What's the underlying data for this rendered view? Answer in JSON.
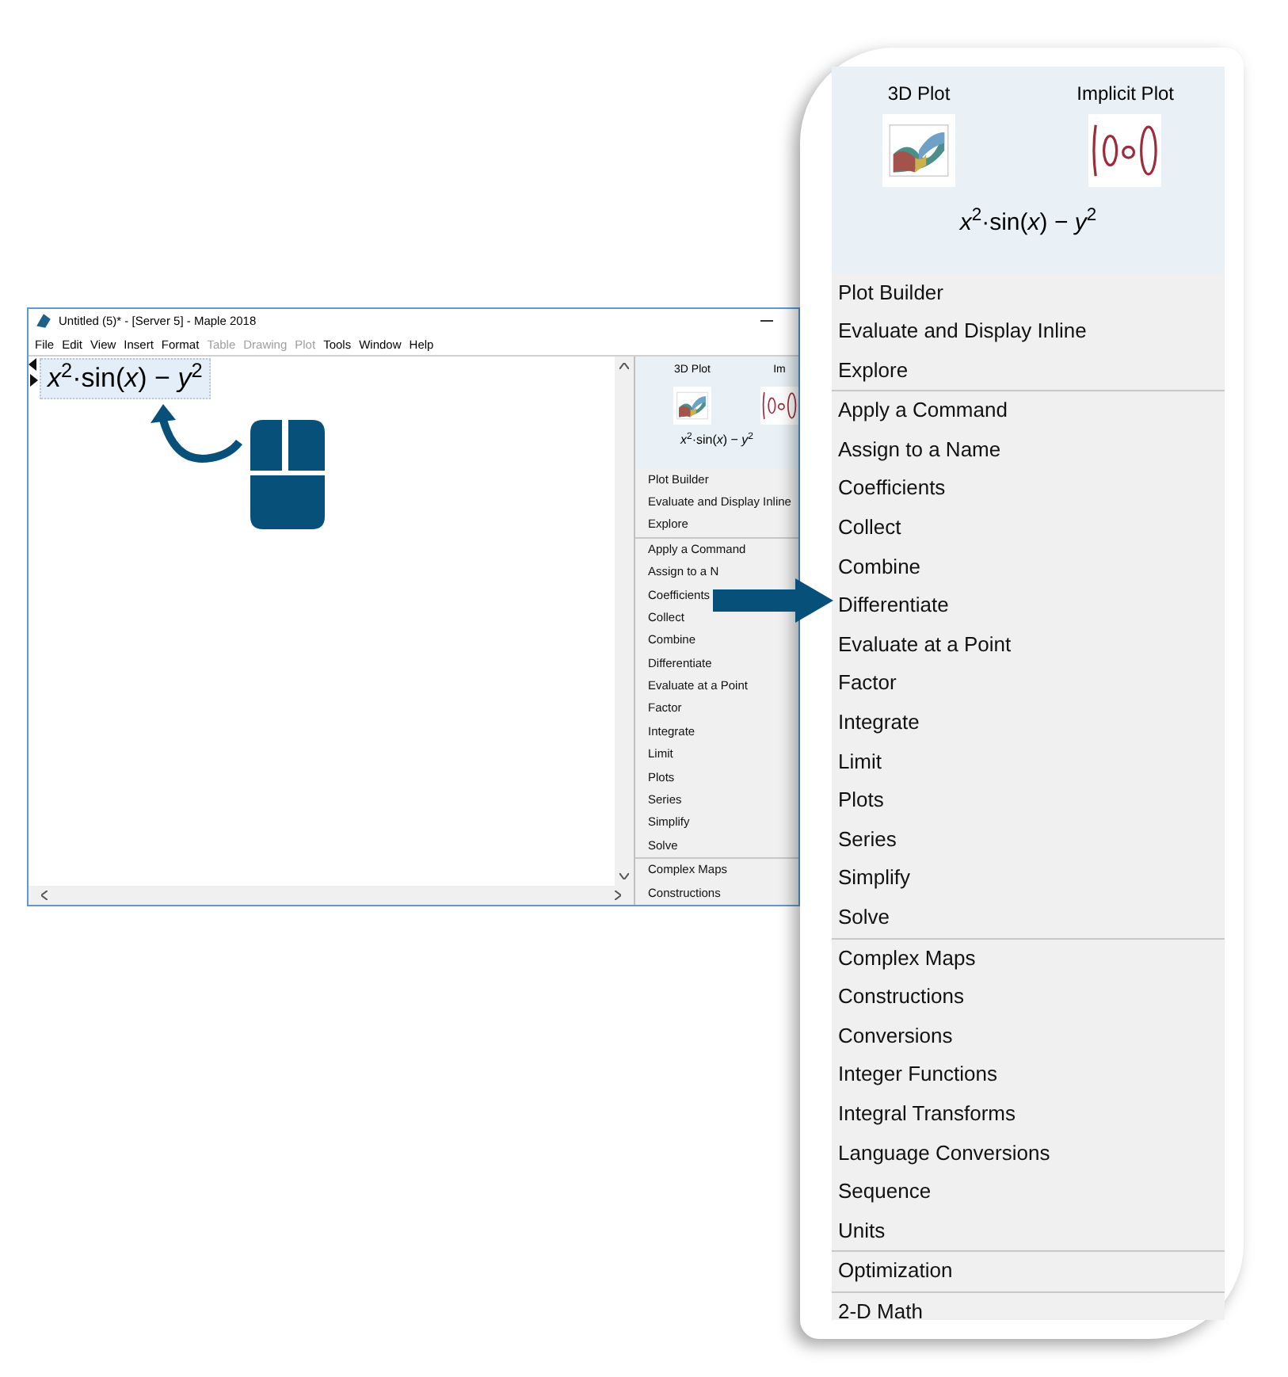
{
  "window": {
    "title": "Untitled (5)* - [Server 5] - Maple 2018",
    "menu": [
      {
        "label": "File",
        "disabled": false
      },
      {
        "label": "Edit",
        "disabled": false
      },
      {
        "label": "View",
        "disabled": false
      },
      {
        "label": "Insert",
        "disabled": false
      },
      {
        "label": "Format",
        "disabled": false
      },
      {
        "label": "Table",
        "disabled": true
      },
      {
        "label": "Drawing",
        "disabled": true
      },
      {
        "label": "Plot",
        "disabled": true
      },
      {
        "label": "Tools",
        "disabled": false
      },
      {
        "label": "Window",
        "disabled": false
      },
      {
        "label": "Help",
        "disabled": false
      }
    ],
    "expression": "*x*$^{2}$·sin(*x*) − *y*$^{2}$",
    "palette": {
      "plots": [
        {
          "label": "3D Plot",
          "kind": "surface"
        },
        {
          "label": "Im",
          "kind": "implicit"
        }
      ],
      "expression": "*x*$^{2}$·sin(*x*) − *y*$^{2}$",
      "groups": [
        [
          "Plot Builder",
          "Evaluate and Display Inline",
          "Explore"
        ],
        [
          "Apply a Command",
          "Assign to a N",
          "Coefficients",
          "Collect",
          "Combine",
          "Differentiate",
          "Evaluate at a Point",
          "Factor",
          "Integrate",
          "Limit",
          "Plots",
          "Series",
          "Simplify",
          "Solve"
        ],
        [
          "Complex Maps",
          "Constructions"
        ]
      ]
    }
  },
  "callout": {
    "plots": [
      {
        "label": "3D Plot",
        "kind": "surface"
      },
      {
        "label": "Implicit Plot",
        "kind": "implicit"
      }
    ],
    "expression": "*x*$^{2}$·sin(*x*) − *y*$^{2}$",
    "groups": [
      [
        "Plot Builder",
        "Evaluate and Display Inline",
        "Explore"
      ],
      [
        "Apply a Command",
        "Assign to a Name",
        "Coefficients",
        "Collect",
        "Combine",
        "Differentiate",
        "Evaluate at a Point",
        "Factor",
        "Integrate",
        "Limit",
        "Plots",
        "Series",
        "Simplify",
        "Solve"
      ],
      [
        "Complex Maps",
        "Constructions",
        "Conversions",
        "Integer Functions",
        "Integral Transforms",
        "Language Conversions",
        "Sequence",
        "Units"
      ],
      [
        "Optimization"
      ],
      [
        "2-D Math"
      ]
    ]
  }
}
